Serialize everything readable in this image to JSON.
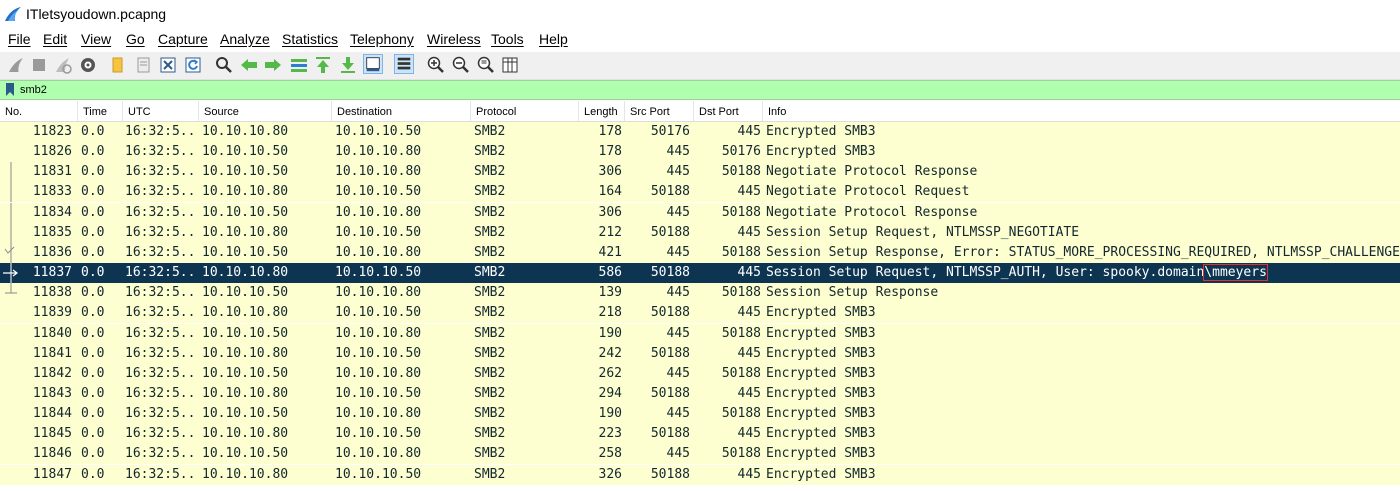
{
  "window": {
    "title": "ITletsyoudown.pcapng"
  },
  "menu": [
    "File",
    "Edit",
    "View",
    "Go",
    "Capture",
    "Analyze",
    "Statistics",
    "Telephony",
    "Wireless",
    "Tools",
    "Help"
  ],
  "filter": {
    "value": "smb2"
  },
  "columns": [
    "No.",
    "Time",
    "UTC",
    "Source",
    "Destination",
    "Protocol",
    "Length",
    "Src Port",
    "Dst Port",
    "Info"
  ],
  "packets": [
    {
      "no": "11823",
      "time": "0.0",
      "utc": "16:32:5...",
      "src": "10.10.10.80",
      "dst": "10.10.10.50",
      "proto": "SMB2",
      "len": "178",
      "sport": "50176",
      "dport": "445",
      "info": "Encrypted SMB3"
    },
    {
      "no": "11826",
      "time": "0.0",
      "utc": "16:32:5...",
      "src": "10.10.10.50",
      "dst": "10.10.10.80",
      "proto": "SMB2",
      "len": "178",
      "sport": "445",
      "dport": "50176",
      "info": "Encrypted SMB3"
    },
    {
      "no": "11831",
      "time": "0.0",
      "utc": "16:32:5...",
      "src": "10.10.10.50",
      "dst": "10.10.10.80",
      "proto": "SMB2",
      "len": "306",
      "sport": "445",
      "dport": "50188",
      "info": "Negotiate Protocol Response"
    },
    {
      "no": "11833",
      "time": "0.0",
      "utc": "16:32:5...",
      "src": "10.10.10.80",
      "dst": "10.10.10.50",
      "proto": "SMB2",
      "len": "164",
      "sport": "50188",
      "dport": "445",
      "info": "Negotiate Protocol Request"
    },
    {
      "no": "11834",
      "time": "0.0",
      "utc": "16:32:5...",
      "src": "10.10.10.50",
      "dst": "10.10.10.80",
      "proto": "SMB2",
      "len": "306",
      "sport": "445",
      "dport": "50188",
      "info": "Negotiate Protocol Response"
    },
    {
      "no": "11835",
      "time": "0.0",
      "utc": "16:32:5...",
      "src": "10.10.10.80",
      "dst": "10.10.10.50",
      "proto": "SMB2",
      "len": "212",
      "sport": "50188",
      "dport": "445",
      "info": "Session Setup Request, NTLMSSP_NEGOTIATE"
    },
    {
      "no": "11836",
      "time": "0.0",
      "utc": "16:32:5...",
      "src": "10.10.10.50",
      "dst": "10.10.10.80",
      "proto": "SMB2",
      "len": "421",
      "sport": "445",
      "dport": "50188",
      "info": "Session Setup Response, Error: STATUS_MORE_PROCESSING_REQUIRED, NTLMSSP_CHALLENGE"
    },
    {
      "no": "11837",
      "time": "0.0",
      "utc": "16:32:5...",
      "src": "10.10.10.80",
      "dst": "10.10.10.50",
      "proto": "SMB2",
      "len": "586",
      "sport": "50188",
      "dport": "445",
      "info": "Session Setup Request, NTLMSSP_AUTH, User: spooky.domain",
      "info_highlight": "\\mmeyers",
      "selected": true
    },
    {
      "no": "11838",
      "time": "0.0",
      "utc": "16:32:5...",
      "src": "10.10.10.50",
      "dst": "10.10.10.80",
      "proto": "SMB2",
      "len": "139",
      "sport": "445",
      "dport": "50188",
      "info": "Session Setup Response"
    },
    {
      "no": "11839",
      "time": "0.0",
      "utc": "16:32:5...",
      "src": "10.10.10.80",
      "dst": "10.10.10.50",
      "proto": "SMB2",
      "len": "218",
      "sport": "50188",
      "dport": "445",
      "info": "Encrypted SMB3"
    },
    {
      "no": "11840",
      "time": "0.0",
      "utc": "16:32:5...",
      "src": "10.10.10.50",
      "dst": "10.10.10.80",
      "proto": "SMB2",
      "len": "190",
      "sport": "445",
      "dport": "50188",
      "info": "Encrypted SMB3"
    },
    {
      "no": "11841",
      "time": "0.0",
      "utc": "16:32:5...",
      "src": "10.10.10.80",
      "dst": "10.10.10.50",
      "proto": "SMB2",
      "len": "242",
      "sport": "50188",
      "dport": "445",
      "info": "Encrypted SMB3"
    },
    {
      "no": "11842",
      "time": "0.0",
      "utc": "16:32:5...",
      "src": "10.10.10.50",
      "dst": "10.10.10.80",
      "proto": "SMB2",
      "len": "262",
      "sport": "445",
      "dport": "50188",
      "info": "Encrypted SMB3"
    },
    {
      "no": "11843",
      "time": "0.0",
      "utc": "16:32:5...",
      "src": "10.10.10.80",
      "dst": "10.10.10.50",
      "proto": "SMB2",
      "len": "294",
      "sport": "50188",
      "dport": "445",
      "info": "Encrypted SMB3"
    },
    {
      "no": "11844",
      "time": "0.0",
      "utc": "16:32:5...",
      "src": "10.10.10.50",
      "dst": "10.10.10.80",
      "proto": "SMB2",
      "len": "190",
      "sport": "445",
      "dport": "50188",
      "info": "Encrypted SMB3"
    },
    {
      "no": "11845",
      "time": "0.0",
      "utc": "16:32:5...",
      "src": "10.10.10.80",
      "dst": "10.10.10.50",
      "proto": "SMB2",
      "len": "223",
      "sport": "50188",
      "dport": "445",
      "info": "Encrypted SMB3"
    },
    {
      "no": "11846",
      "time": "0.0",
      "utc": "16:32:5...",
      "src": "10.10.10.50",
      "dst": "10.10.10.80",
      "proto": "SMB2",
      "len": "258",
      "sport": "445",
      "dport": "50188",
      "info": "Encrypted SMB3"
    },
    {
      "no": "11847",
      "time": "0.0",
      "utc": "16:32:5...",
      "src": "10.10.10.80",
      "dst": "10.10.10.50",
      "proto": "SMB2",
      "len": "326",
      "sport": "50188",
      "dport": "445",
      "info": "Encrypted SMB3"
    }
  ],
  "colors": {
    "row_bg": "#feffd0",
    "selected_bg": "#0d3552",
    "filter_bg": "#afffaf",
    "highlight_box": "#e03030"
  }
}
